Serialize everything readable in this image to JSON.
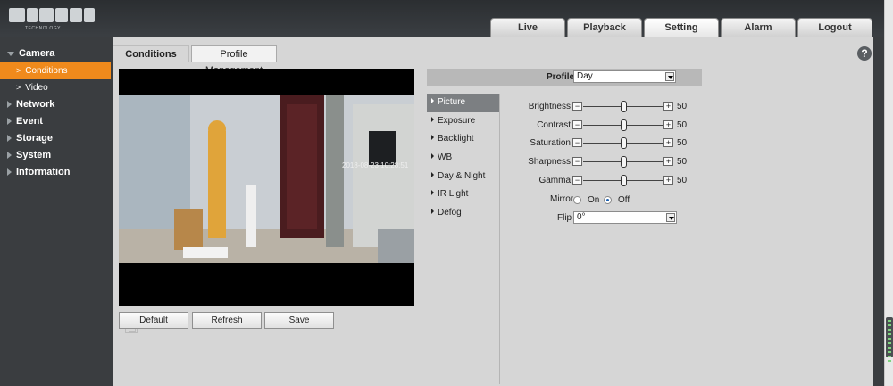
{
  "header": {
    "logo_text": "TECHNOLOGY",
    "tabs": [
      "Live",
      "Playback",
      "Setting",
      "Alarm",
      "Logout"
    ],
    "active_tab": "Setting"
  },
  "sidebar": {
    "camera": "Camera",
    "camera_items": [
      "Conditions",
      "Video"
    ],
    "sections": [
      "Network",
      "Event",
      "Storage",
      "System",
      "Information"
    ]
  },
  "main": {
    "tabs": [
      "Conditions",
      "Profile Management"
    ],
    "help": "?",
    "osd_time": "2018-08-23 10:28:51",
    "buttons": {
      "default": "Default",
      "refresh": "Refresh",
      "save": "Save"
    },
    "profile": {
      "label": "Profile",
      "value": "Day"
    },
    "menu": [
      "Picture",
      "Exposure",
      "Backlight",
      "WB",
      "Day & Night",
      "IR Light",
      "Defog"
    ],
    "active_menu": "Picture",
    "sliders": [
      {
        "label": "Brightness",
        "value": "50",
        "level": 0.5
      },
      {
        "label": "Contrast",
        "value": "50",
        "level": 0.5
      },
      {
        "label": "Saturation",
        "value": "50",
        "level": 0.5
      },
      {
        "label": "Sharpness",
        "value": "50",
        "level": 0.5
      },
      {
        "label": "Gamma",
        "value": "50",
        "level": 0.5
      }
    ],
    "mirror": {
      "label": "Mirror",
      "on": "On",
      "off": "Off",
      "selected": "Off"
    },
    "flip": {
      "label": "Flip",
      "value": "0°"
    }
  },
  "colors": {
    "accent": "#f08a1c",
    "sidebar_bg": "#3a3d40",
    "panel_bg": "#d6d6d6"
  }
}
